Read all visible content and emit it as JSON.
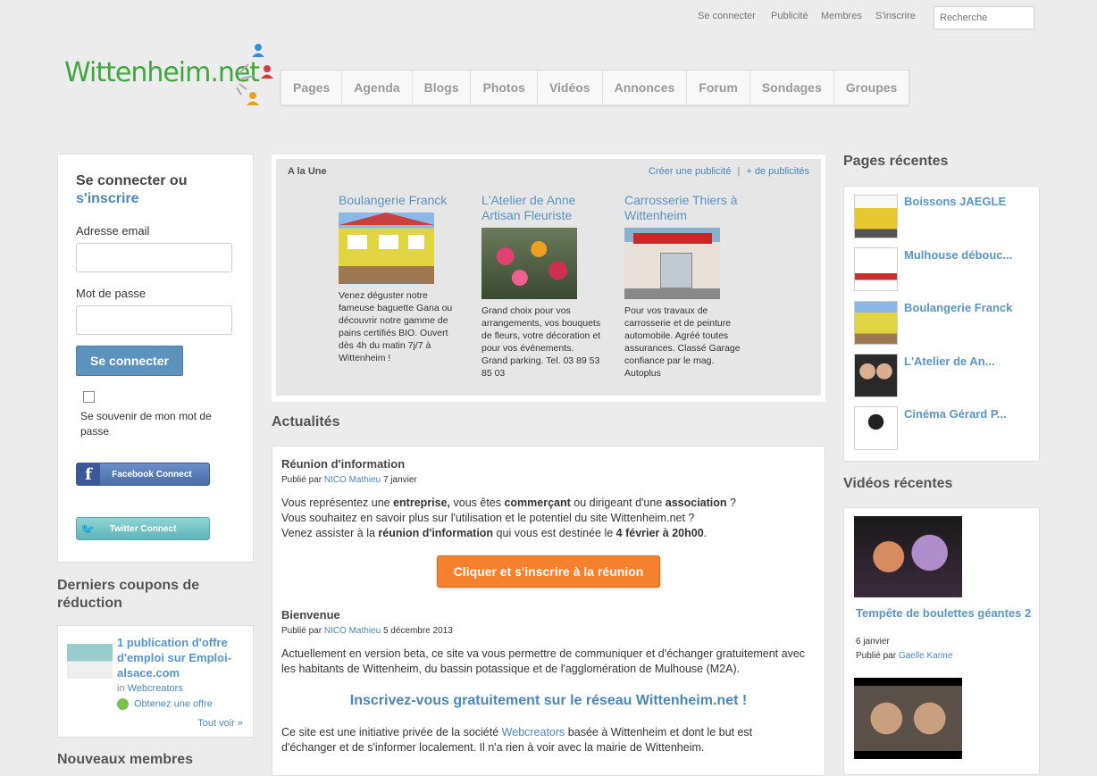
{
  "toplinks": [
    "Se connecter",
    "Publicité",
    "Membres",
    "S'inscrire"
  ],
  "search": {
    "placeholder": "Recherche"
  },
  "logo": {
    "text": "Wittenheim.net"
  },
  "nav": [
    "Pages",
    "Agenda",
    "Blogs",
    "Photos",
    "Vidéos",
    "Annonces",
    "Forum",
    "Sondages",
    "Groupes"
  ],
  "login": {
    "title_1": "Se connecter ou",
    "title_2": "s'inscrire",
    "email_label": "Adresse email",
    "password_label": "Mot de passe",
    "submit": "Se connecter",
    "remember": "Se souvenir de mon mot de passe",
    "facebook": "Facebook Connect",
    "twitter": "Twitter Connect"
  },
  "coupons": {
    "title": "Derniers coupons de réduction",
    "item_title": "1 publication d'offre d'emploi sur Emploi-alsace.com",
    "in_label": "in",
    "in_link": "Webcreators",
    "get_offer": "Obtenez une offre",
    "see_all": "Tout voir »"
  },
  "new_members": {
    "title": "Nouveaux membres"
  },
  "featured": {
    "heading": "A la Une",
    "create_link": "Créer une publicité",
    "separator": "|",
    "more_link": "+ de publicités",
    "items": [
      {
        "title": "Boulangerie Franck",
        "desc": "Venez déguster notre fameuse baguette Gana ou découvrir notre gamme de pains certifiés BIO. Ouvert dès 4h du matin 7j/7 à Wittenheim !"
      },
      {
        "title": "L'Atelier de Anne Artisan Fleuriste",
        "desc": "Grand choix pour vos arrangements, vos bouquets de fleurs, votre décoration et pour vos événements. Grand parking. Tel. 03 89 53 85 03"
      },
      {
        "title": "Carrosserie Thiers à Wittenheim",
        "desc": "Pour vos travaux de carrosserie et de peinture automobile. Agréé toutes assurances. Classé Garage confiance par le mag. Autoplus"
      }
    ]
  },
  "news": {
    "title": "Actualités",
    "post1": {
      "title": "Réunion d'information",
      "published_by": "Publié par",
      "author": "NICO Mathieu",
      "date": "7 janvier",
      "l1a": "Vous représentez une ",
      "l1b": "entreprise,",
      "l1c": " vous êtes ",
      "l1d": "commerçant",
      "l1e": " ou dirigeant d'une ",
      "l1f": "association",
      "l1g": " ?",
      "l2": "Vous souhaitez en savoir plus sur l'utilisation et le potentiel du site Wittenheim.net ?",
      "l3a": "Venez assister à la ",
      "l3b": "réunion d'information",
      "l3c": " qui vous est destinée le ",
      "l3d": "4 février à 20h00",
      "l3e": ".",
      "button": "Cliquer et s'inscrire à la réunion"
    },
    "post2": {
      "title": "Bienvenue",
      "published_by": "Publié par",
      "author": "NICO Mathieu",
      "date": "5 décembre 2013",
      "p1": "Actuellement en version beta, ce site va vous permettre de communiquer et d'échanger gratuitement avec les habitants de Wittenheim, du bassin potassique et de l'agglomération de Mulhouse (M2A).",
      "cta": "Inscrivez-vous gratuitement sur le réseau Wittenheim.net !",
      "p2a": "Ce site est une initiative privée de la société ",
      "p2b": "Webcreators",
      "p2c": " basée à Wittenheim et dont le but est d'échanger et de s'informer localement. Il n'a rien à voir avec la mairie de Wittenheim."
    }
  },
  "recent_pages": {
    "title": "Pages récentes",
    "items": [
      "Boissons JAEGLE",
      "Mulhouse débouc...",
      "Boulangerie Franck",
      "L'Atelier de An...",
      "Cinéma Gérard P..."
    ]
  },
  "recent_videos": {
    "title": "Vidéos récentes",
    "v1_title": "Tempête de boulettes géantes 2",
    "v1_date": "6 janvier",
    "v1_by": "Publié par",
    "v1_author": "Gaelle Karine"
  }
}
